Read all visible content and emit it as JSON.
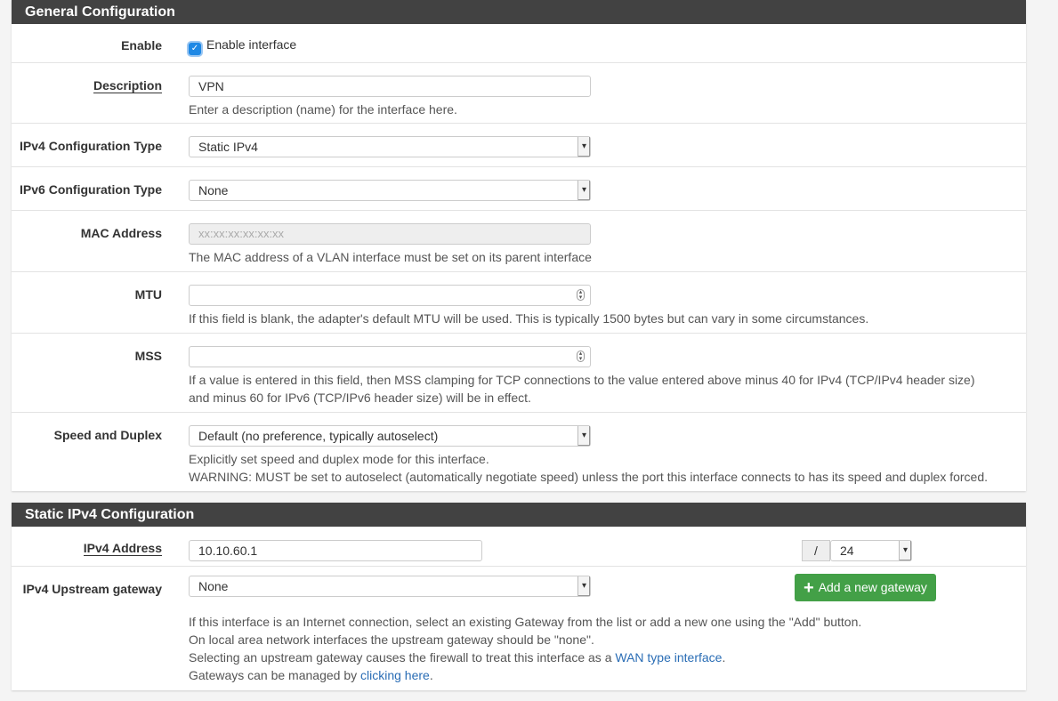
{
  "general": {
    "title": "General Configuration",
    "enable_label": "Enable",
    "enable_text": "Enable interface",
    "enable_checked": true,
    "description_label": "Description",
    "description_value": "VPN",
    "description_help": "Enter a description (name) for the interface here.",
    "ipv4_type_label": "IPv4 Configuration Type",
    "ipv4_type_value": "Static IPv4",
    "ipv6_type_label": "IPv6 Configuration Type",
    "ipv6_type_value": "None",
    "mac_label": "MAC Address",
    "mac_placeholder": "xx:xx:xx:xx:xx:xx",
    "mac_help": "The MAC address of a VLAN interface must be set on its parent interface",
    "mtu_label": "MTU",
    "mtu_help": "If this field is blank, the adapter's default MTU will be used. This is typically 1500 bytes but can vary in some circumstances.",
    "mss_label": "MSS",
    "mss_help": "If a value is entered in this field, then MSS clamping for TCP connections to the value entered above minus 40 for IPv4 (TCP/IPv4 header size) and minus 60 for IPv6 (TCP/IPv6 header size) will be in effect.",
    "speed_label": "Speed and Duplex",
    "speed_value": "Default (no preference, typically autoselect)",
    "speed_help1": "Explicitly set speed and duplex mode for this interface.",
    "speed_help2": "WARNING: MUST be set to autoselect (automatically negotiate speed) unless the port this interface connects to has its speed and duplex forced."
  },
  "static": {
    "title": "Static IPv4 Configuration",
    "address_label": "IPv4 Address",
    "address_value": "10.10.60.1",
    "slash": "/",
    "cidr_value": "24",
    "gateway_label": "IPv4 Upstream gateway",
    "gateway_value": "None",
    "add_gateway": "Add a new gateway",
    "help1": "If this interface is an Internet connection, select an existing Gateway from the list or add a new one using the \"Add\" button.",
    "help2": "On local area network interfaces the upstream gateway should be \"none\".",
    "help3_pre": "Selecting an upstream gateway causes the firewall to treat this interface as a ",
    "help3_link": "WAN type interface",
    "help3_post": ".",
    "help4_pre": "Gateways can be managed by ",
    "help4_link": "clicking here",
    "help4_post": "."
  }
}
